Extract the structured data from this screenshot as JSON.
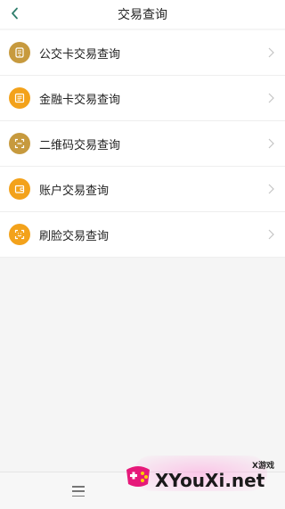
{
  "header": {
    "title": "交易查询",
    "back_icon": "chevron-left-icon"
  },
  "items": [
    {
      "label": "公交卡交易查询",
      "icon": "bus-card-icon"
    },
    {
      "label": "金融卡交易查询",
      "icon": "bank-card-icon"
    },
    {
      "label": "二维码交易查询",
      "icon": "qr-code-icon"
    },
    {
      "label": "账户交易查询",
      "icon": "wallet-icon"
    },
    {
      "label": "刷脸交易查询",
      "icon": "face-scan-icon"
    }
  ],
  "bottom": {
    "menu_icon": "menu-icon"
  },
  "watermark": {
    "sub": "X游戏",
    "main": "XYouXi.net"
  },
  "colors": {
    "accent": "#f3a21b",
    "accent_dark": "#c79a3e",
    "back_icon": "#2e7d6b"
  }
}
